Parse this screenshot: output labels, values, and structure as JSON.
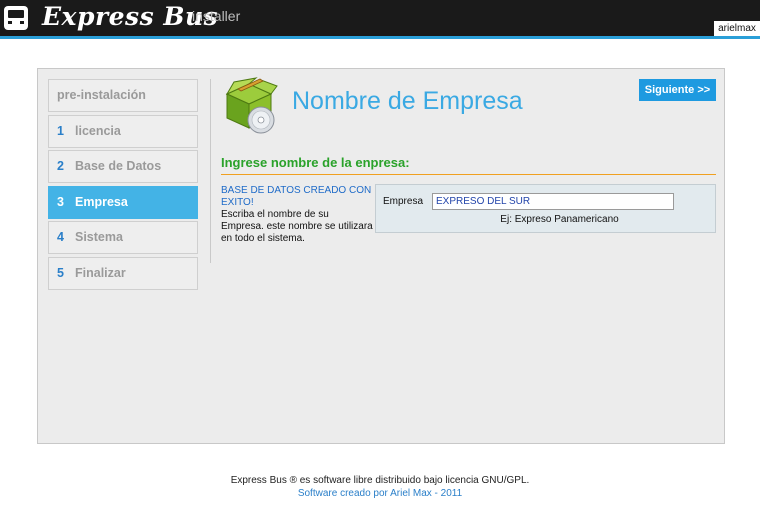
{
  "header": {
    "brand": "Express Bus",
    "subtitle": "installer",
    "user": "arielmax",
    "logo_icon": "bus-icon"
  },
  "sidebar": {
    "items": [
      {
        "num": "",
        "label": "pre-instalación",
        "state": "inactive"
      },
      {
        "num": "1",
        "label": "licencia",
        "state": "inactive"
      },
      {
        "num": "2",
        "label": "Base de Datos",
        "state": "inactive"
      },
      {
        "num": "3",
        "label": "Empresa",
        "state": "active"
      },
      {
        "num": "4",
        "label": "Sistema",
        "state": "inactive"
      },
      {
        "num": "5",
        "label": "Finalizar",
        "state": "inactive"
      }
    ]
  },
  "main": {
    "title": "Nombre de Empresa",
    "title_icon": "software-package-icon",
    "next_button": "Siguiente >>",
    "section_heading": "Ingrese nombre de la enpresa:",
    "status_message": "BASE DE DATOS CREADO CON EXITO!",
    "instructions": "Escriba el nombre de su Empresa. este nombre se utilizara en todo el sistema.",
    "form": {
      "label": "Empresa",
      "value": "EXPRESO DEL SUR",
      "hint": "Ej: Expreso Panamericano"
    }
  },
  "footer": {
    "license": "Express Bus ® es software libre distribuido bajo licencia GNU/GPL.",
    "credit": "Software creado por Ariel Max - 2011"
  },
  "colors": {
    "accent": "#43b3e6",
    "header_bg": "#1a1a1a",
    "button": "#1e9ae0",
    "section_heading": "#2aa22a",
    "divider": "#f0a020"
  }
}
